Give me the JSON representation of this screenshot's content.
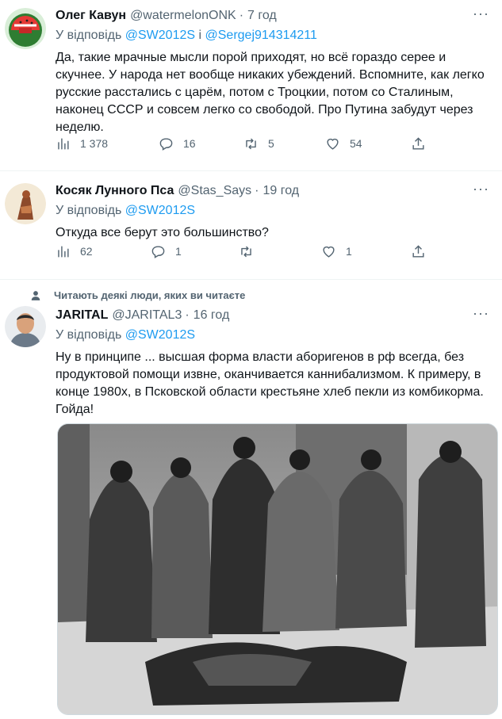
{
  "tweets": [
    {
      "name": "Олег Кавун",
      "handle": "@watermelonONK",
      "separator": "·",
      "time": "7 год",
      "reply_prefix": "У відповідь",
      "reply_to_1": "@SW2012S",
      "reply_and": "і",
      "reply_to_2": "@Sergej914314211",
      "text": "Да, такие мрачные мысли порой приходят, но всё гораздо серее и скучнее. У народа нет вообще никаких убеждений. Вспомните, как легко русские расстались с царём, потом с Троцкии, потом со Сталиным, наконец СССР и совсем легко со свободой. Про Путина забудут через неделю.",
      "views": "1 378",
      "replies": "16",
      "retweets": "5",
      "likes": "54",
      "more": "···"
    },
    {
      "name": "Косяк Лунного Пса",
      "handle": "@Stas_Says",
      "separator": "·",
      "time": "19 год",
      "reply_prefix": "У відповідь",
      "reply_to_1": "@SW2012S",
      "text": "Откуда все берут это большинство?",
      "views": "62",
      "replies": "1",
      "likes": "1",
      "more": "···"
    },
    {
      "social_context": "Читають деякі люди, яких ви читаєте",
      "name": "JARITAL",
      "handle": "@JARITAL3",
      "separator": "·",
      "time": "16 год",
      "reply_prefix": "У відповідь",
      "reply_to_1": "@SW2012S",
      "text": "Ну в принципе ... высшая форма власти аборигенов в рф всегда, без продуктовой помощи извне, оканчивается каннибализмом. К примеру, в конце 1980х, в Псковской области крестьяне хлеб пекли из комбикорма. Гойда!",
      "more": "···"
    }
  ],
  "colors": {
    "link": "#1d9bf0",
    "secondary": "#536471",
    "divider": "#eff3f4"
  },
  "icons": [
    "views-icon",
    "reply-icon",
    "retweet-icon",
    "like-icon",
    "share-icon",
    "more-icon",
    "person-icon"
  ]
}
